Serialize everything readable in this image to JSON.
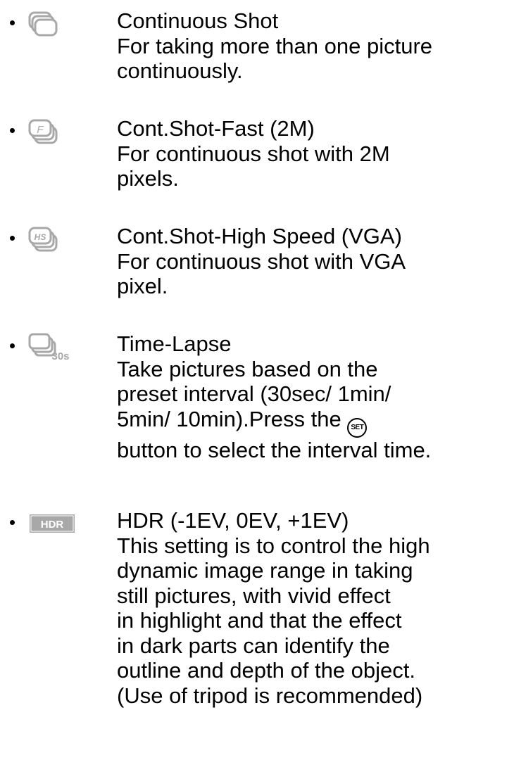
{
  "items": [
    {
      "icon": "continuous-shot-icon",
      "title": "Continuous Shot",
      "lines": [
        "For taking more than one picture",
        "continuously."
      ]
    },
    {
      "icon": "cont-shot-fast-icon",
      "icon_text": "F",
      "title": "Cont.Shot-Fast (2M)",
      "lines": [
        "For continuous shot with 2M",
        "pixels."
      ]
    },
    {
      "icon": "cont-shot-high-speed-icon",
      "icon_text": "HS",
      "title": "Cont.Shot-High Speed (VGA)",
      "lines": [
        "For continuous shot with VGA",
        "pixel."
      ]
    },
    {
      "icon": "time-lapse-icon",
      "icon_text": "30s",
      "title": "Time-Lapse",
      "lines": [
        "Take pictures based on the",
        "preset interval (30sec/ 1min/",
        "5min/ 10min).Press the",
        "button to select the interval time."
      ],
      "set_button": "SET"
    },
    {
      "icon": "hdr-icon",
      "icon_text": "HDR",
      "title": "HDR (-1EV, 0EV, +1EV)",
      "lines": [
        "This setting is to control the high",
        "dynamic image range in taking",
        "still pictures, with vivid effect",
        "in highlight and that the effect",
        "in dark parts can identify the",
        "outline and depth of the object.",
        "(Use of tripod is recommended)"
      ]
    }
  ]
}
